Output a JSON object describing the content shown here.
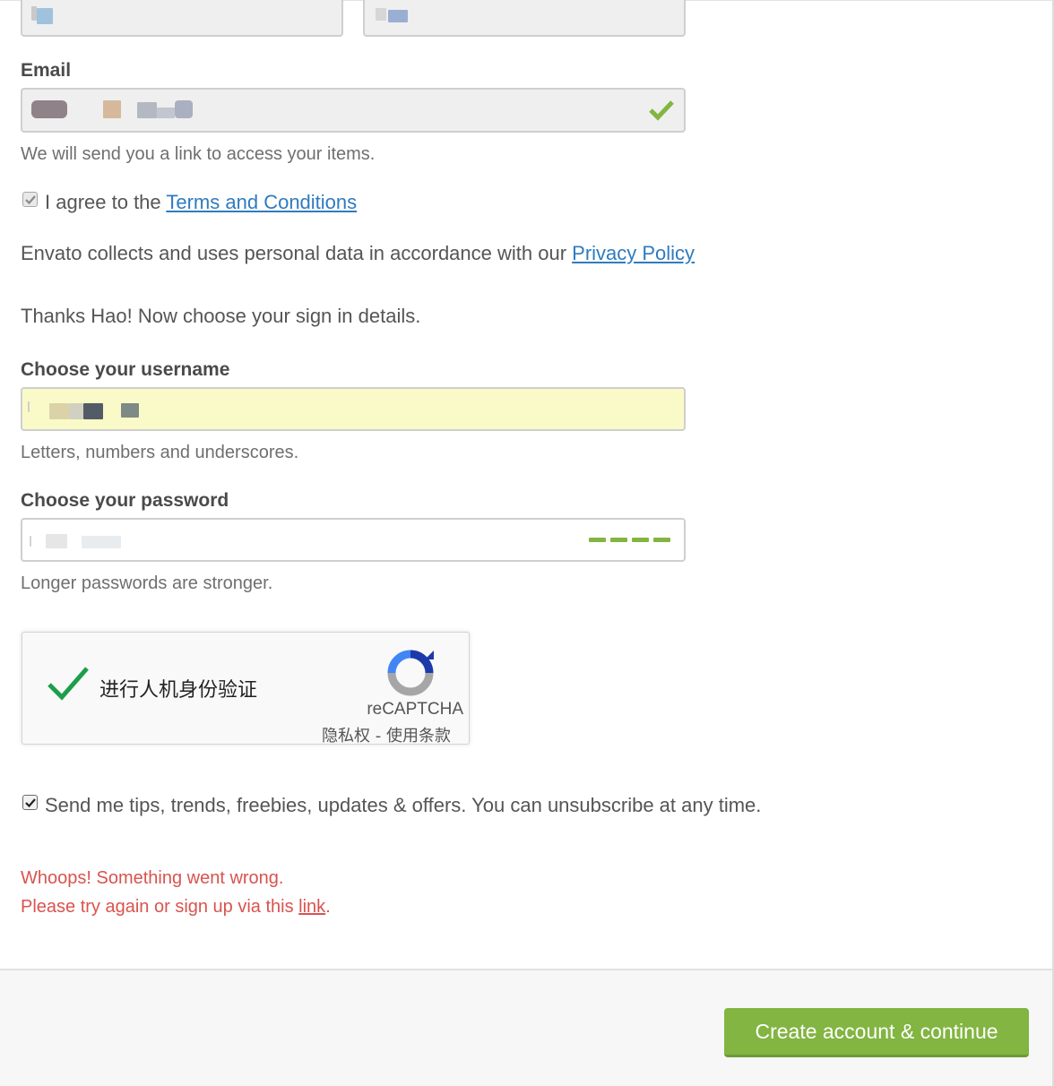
{
  "colors": {
    "accent_green": "#82b541",
    "link_blue": "#2f7bbf",
    "error_red": "#d9534f",
    "autofill_yellow": "#fafac8"
  },
  "email": {
    "label": "Email",
    "help": "We will send you a link to access your items.",
    "valid_icon": "checkmark-icon"
  },
  "terms": {
    "checked": true,
    "prefix": "I agree to the ",
    "link": "Terms and Conditions"
  },
  "privacy": {
    "text": "Envato collects and uses personal data in accordance with our ",
    "link": "Privacy Policy"
  },
  "intro": "Thanks Hao! Now choose your sign in details.",
  "username": {
    "label": "Choose your username",
    "help": "Letters, numbers and underscores."
  },
  "password": {
    "label": "Choose your password",
    "help": "Longer passwords are stronger.",
    "strength_bars": 4
  },
  "recaptcha": {
    "status_icon": "checkmark-icon",
    "label": "进行人机身份验证",
    "brand": "reCAPTCHA",
    "links": "隐私权 - 使用条款"
  },
  "newsletter": {
    "checked": true,
    "label": "Send me tips, trends, freebies, updates & offers. You can unsubscribe at any time."
  },
  "error": {
    "line1": "Whoops! Something went wrong.",
    "line2_prefix": "Please try again or sign up via this ",
    "link": "link",
    "line2_suffix": "."
  },
  "footer": {
    "submit": "Create account & continue"
  }
}
